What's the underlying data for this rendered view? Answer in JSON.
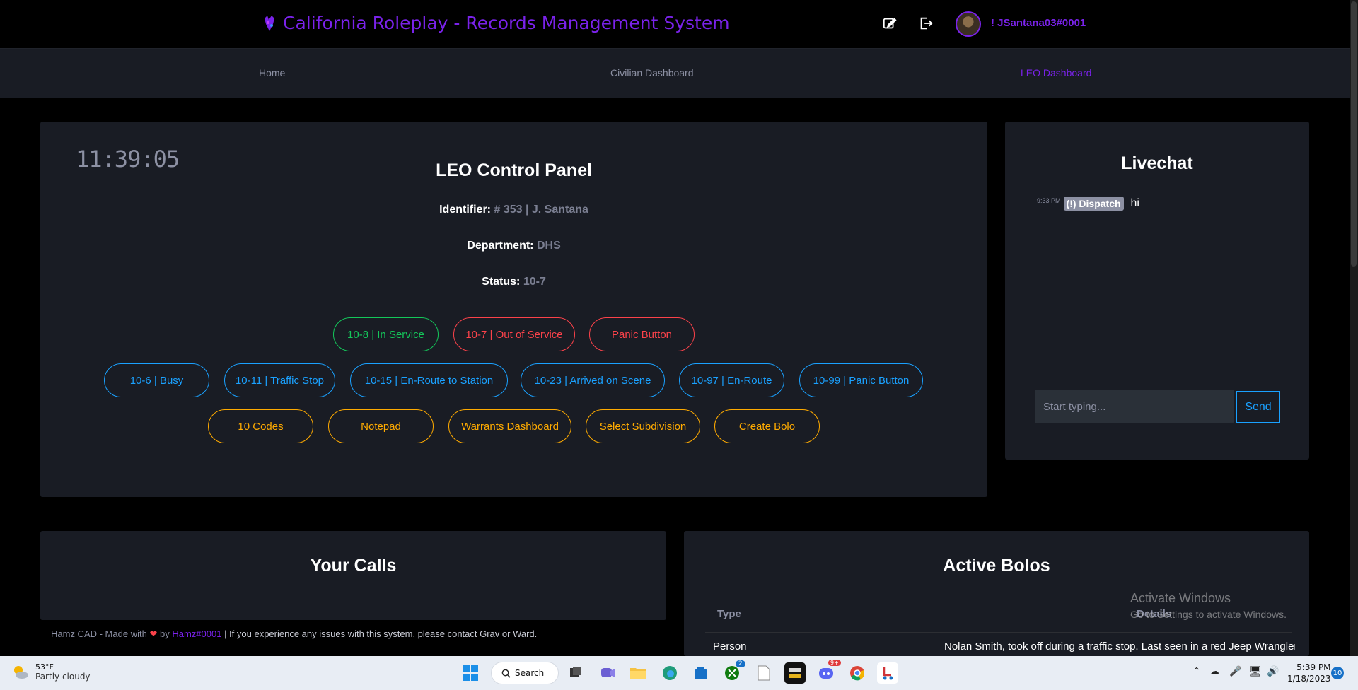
{
  "header": {
    "title": "California Roleplay - Records Management System",
    "username": "! JSantana03#0001",
    "edit_icon": "edit-icon",
    "logout_icon": "logout-icon"
  },
  "nav": {
    "items": [
      {
        "label": "Home"
      },
      {
        "label": "Civilian Dashboard"
      },
      {
        "label": "LEO Dashboard",
        "active": true
      }
    ]
  },
  "control_panel": {
    "clock": "11:39:05",
    "title": "LEO Control Panel",
    "identifier_label": "Identifier:",
    "identifier_value": "# 353 | J. Santana",
    "department_label": "Department:",
    "department_value": "DHS",
    "status_label": "Status:",
    "status_value": "10-7",
    "row1": [
      "10-8 | In Service",
      "10-7 | Out of Service",
      "Panic Button"
    ],
    "row2": [
      "10-6 | Busy",
      "10-11 | Traffic Stop",
      "10-15 | En-Route to Station",
      "10-23 | Arrived on Scene",
      "10-97 | En-Route",
      "10-99 | Panic Button"
    ],
    "row3": [
      "10 Codes",
      "Notepad",
      "Warrants Dashboard",
      "Select Subdivision",
      "Create Bolo"
    ]
  },
  "livechat": {
    "title": "Livechat",
    "message": {
      "time": "9:33 PM",
      "sender": "(!) Dispatch",
      "text": "hi"
    },
    "input_placeholder": "Start typing...",
    "send_label": "Send"
  },
  "calls": {
    "title": "Your Calls"
  },
  "bolos": {
    "title": "Active Bolos",
    "columns": [
      "Type",
      "Details"
    ],
    "rows": [
      {
        "type": "Person",
        "details": "Nolan Smith, took off during a traffic stop. Last seen in a red Jeep Wrangler (l"
      }
    ]
  },
  "watermark": {
    "line1": "Activate Windows",
    "line2": "Go to Settings to activate Windows."
  },
  "footer": {
    "prefix": "Hamz CAD - Made with",
    "by": "by",
    "author": "Hamz#0001",
    "suffix": "| If you experience any issues with this system, please contact Grav or Ward."
  },
  "taskbar": {
    "temperature": "53°F",
    "weather": "Partly cloudy",
    "search_label": "Search",
    "time": "5:39 PM",
    "date": "1/18/2023",
    "notifications": "10",
    "badge_xbox": "2",
    "badge_discord": "9+"
  },
  "colors": {
    "accent": "#7a22ea",
    "green": "#14c65a",
    "red": "#fc424a",
    "blue": "#1aa1ff",
    "orange": "#ffab00",
    "panel": "#191c24"
  }
}
